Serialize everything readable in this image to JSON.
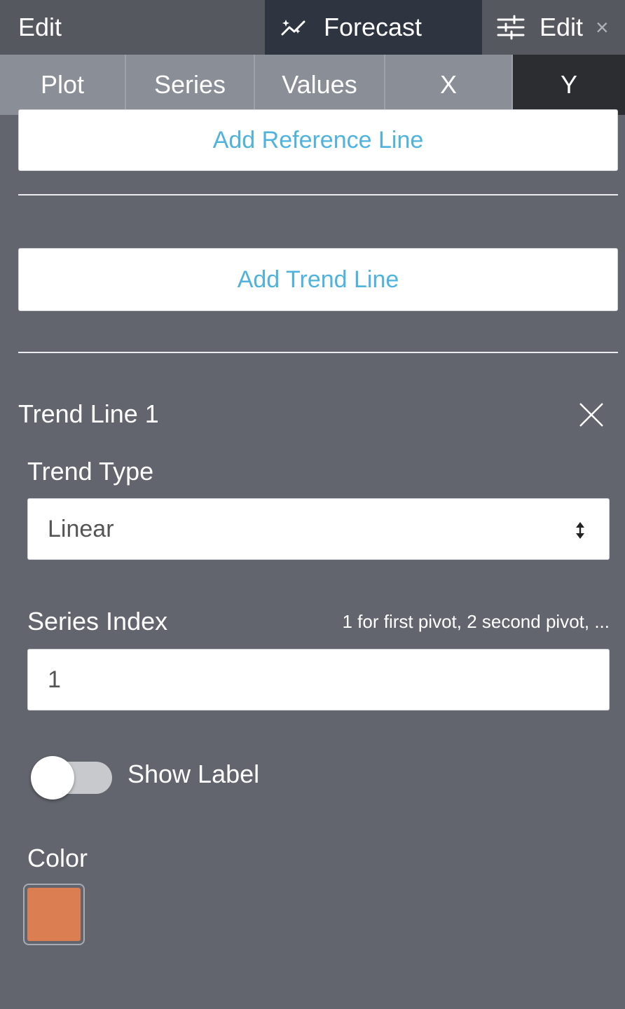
{
  "topbar": {
    "edit_left_label": "Edit",
    "forecast_label": "Forecast",
    "forecast_icon": "sparkle-trend-icon",
    "edit_right_label": "Edit",
    "edit_right_icon": "sliders-icon",
    "close_glyph": "×"
  },
  "tabs": [
    {
      "label": "Plot",
      "active": false
    },
    {
      "label": "Series",
      "active": false
    },
    {
      "label": "Values",
      "active": false
    },
    {
      "label": "X",
      "active": false
    },
    {
      "label": "Y",
      "active": true
    }
  ],
  "reference": {
    "add_label": "Add Reference Line"
  },
  "trend": {
    "add_label": "Add Trend Line",
    "section_title": "Trend Line 1",
    "trend_type_label": "Trend Type",
    "trend_type_value": "Linear",
    "series_index_label": "Series Index",
    "series_index_hint": "1 for first pivot, 2 second pivot, ...",
    "series_index_value": "1",
    "show_label_text": "Show Label",
    "show_label_on": false,
    "color_label": "Color",
    "color_value": "#db7f52"
  },
  "colors": {
    "panel_bg": "#62656d",
    "tab_bar_bg": "#8a8e96",
    "active_tab_bg": "#2b2d31",
    "forecast_tab_bg": "#2e3440",
    "link_blue": "#4fb3dd"
  }
}
